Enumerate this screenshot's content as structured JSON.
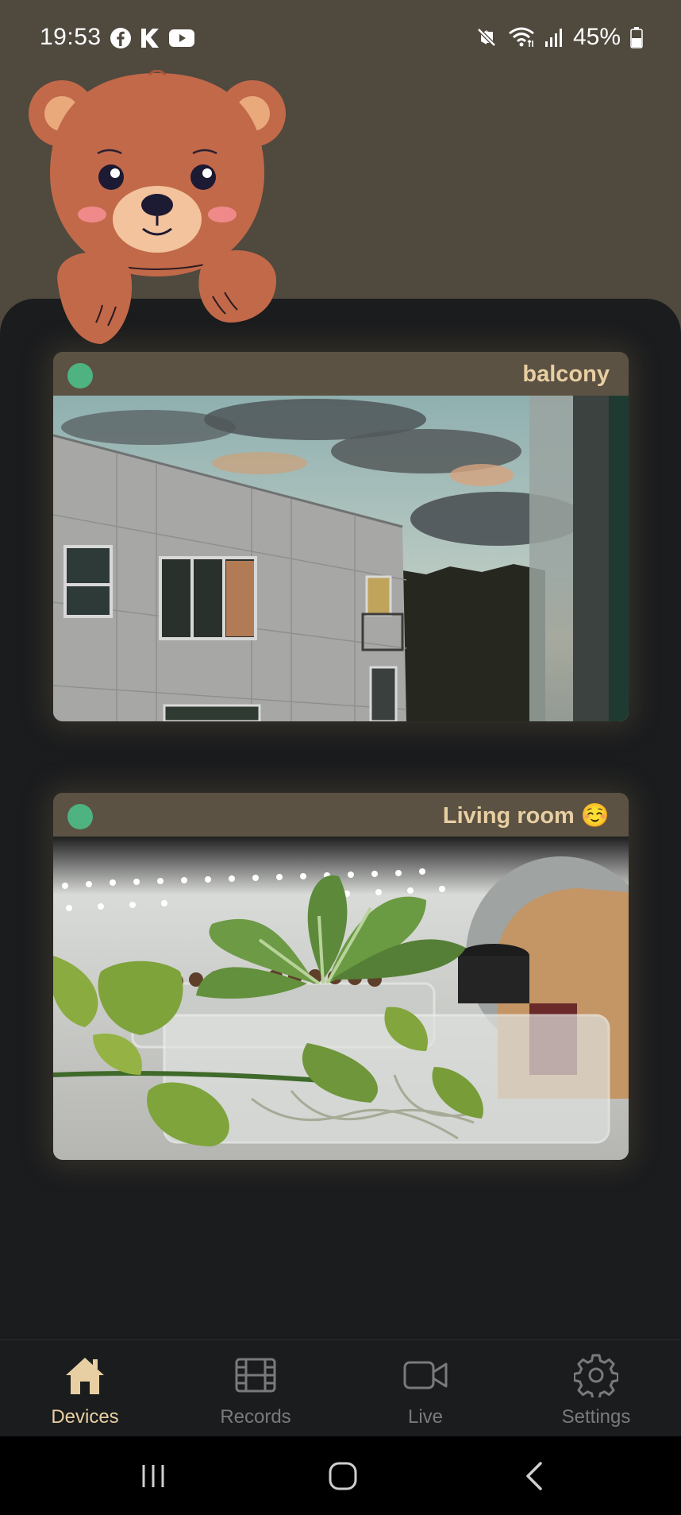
{
  "status_bar": {
    "time": "19:53",
    "left_icons": [
      "facebook-icon",
      "k-app-icon",
      "youtube-icon"
    ],
    "right_icons": [
      "mute-icon",
      "wifi-icon",
      "signal-icon",
      "battery-icon"
    ],
    "battery_percent": "45%"
  },
  "devices": [
    {
      "name": "balcony",
      "status": "online",
      "status_color": "#4fb381"
    },
    {
      "name": "Living room ☺️",
      "status": "online",
      "status_color": "#4fb381"
    }
  ],
  "nav": {
    "items": [
      {
        "label": "Devices",
        "icon": "home-icon",
        "active": true
      },
      {
        "label": "Records",
        "icon": "film-icon",
        "active": false
      },
      {
        "label": "Live",
        "icon": "video-camera-icon",
        "active": false
      },
      {
        "label": "Settings",
        "icon": "gear-icon",
        "active": false
      }
    ]
  },
  "colors": {
    "background": "#4f493e",
    "panel": "#1b1c1e",
    "accent": "#e8cfa3",
    "online": "#4fb381",
    "card_header": "#5c5243"
  }
}
